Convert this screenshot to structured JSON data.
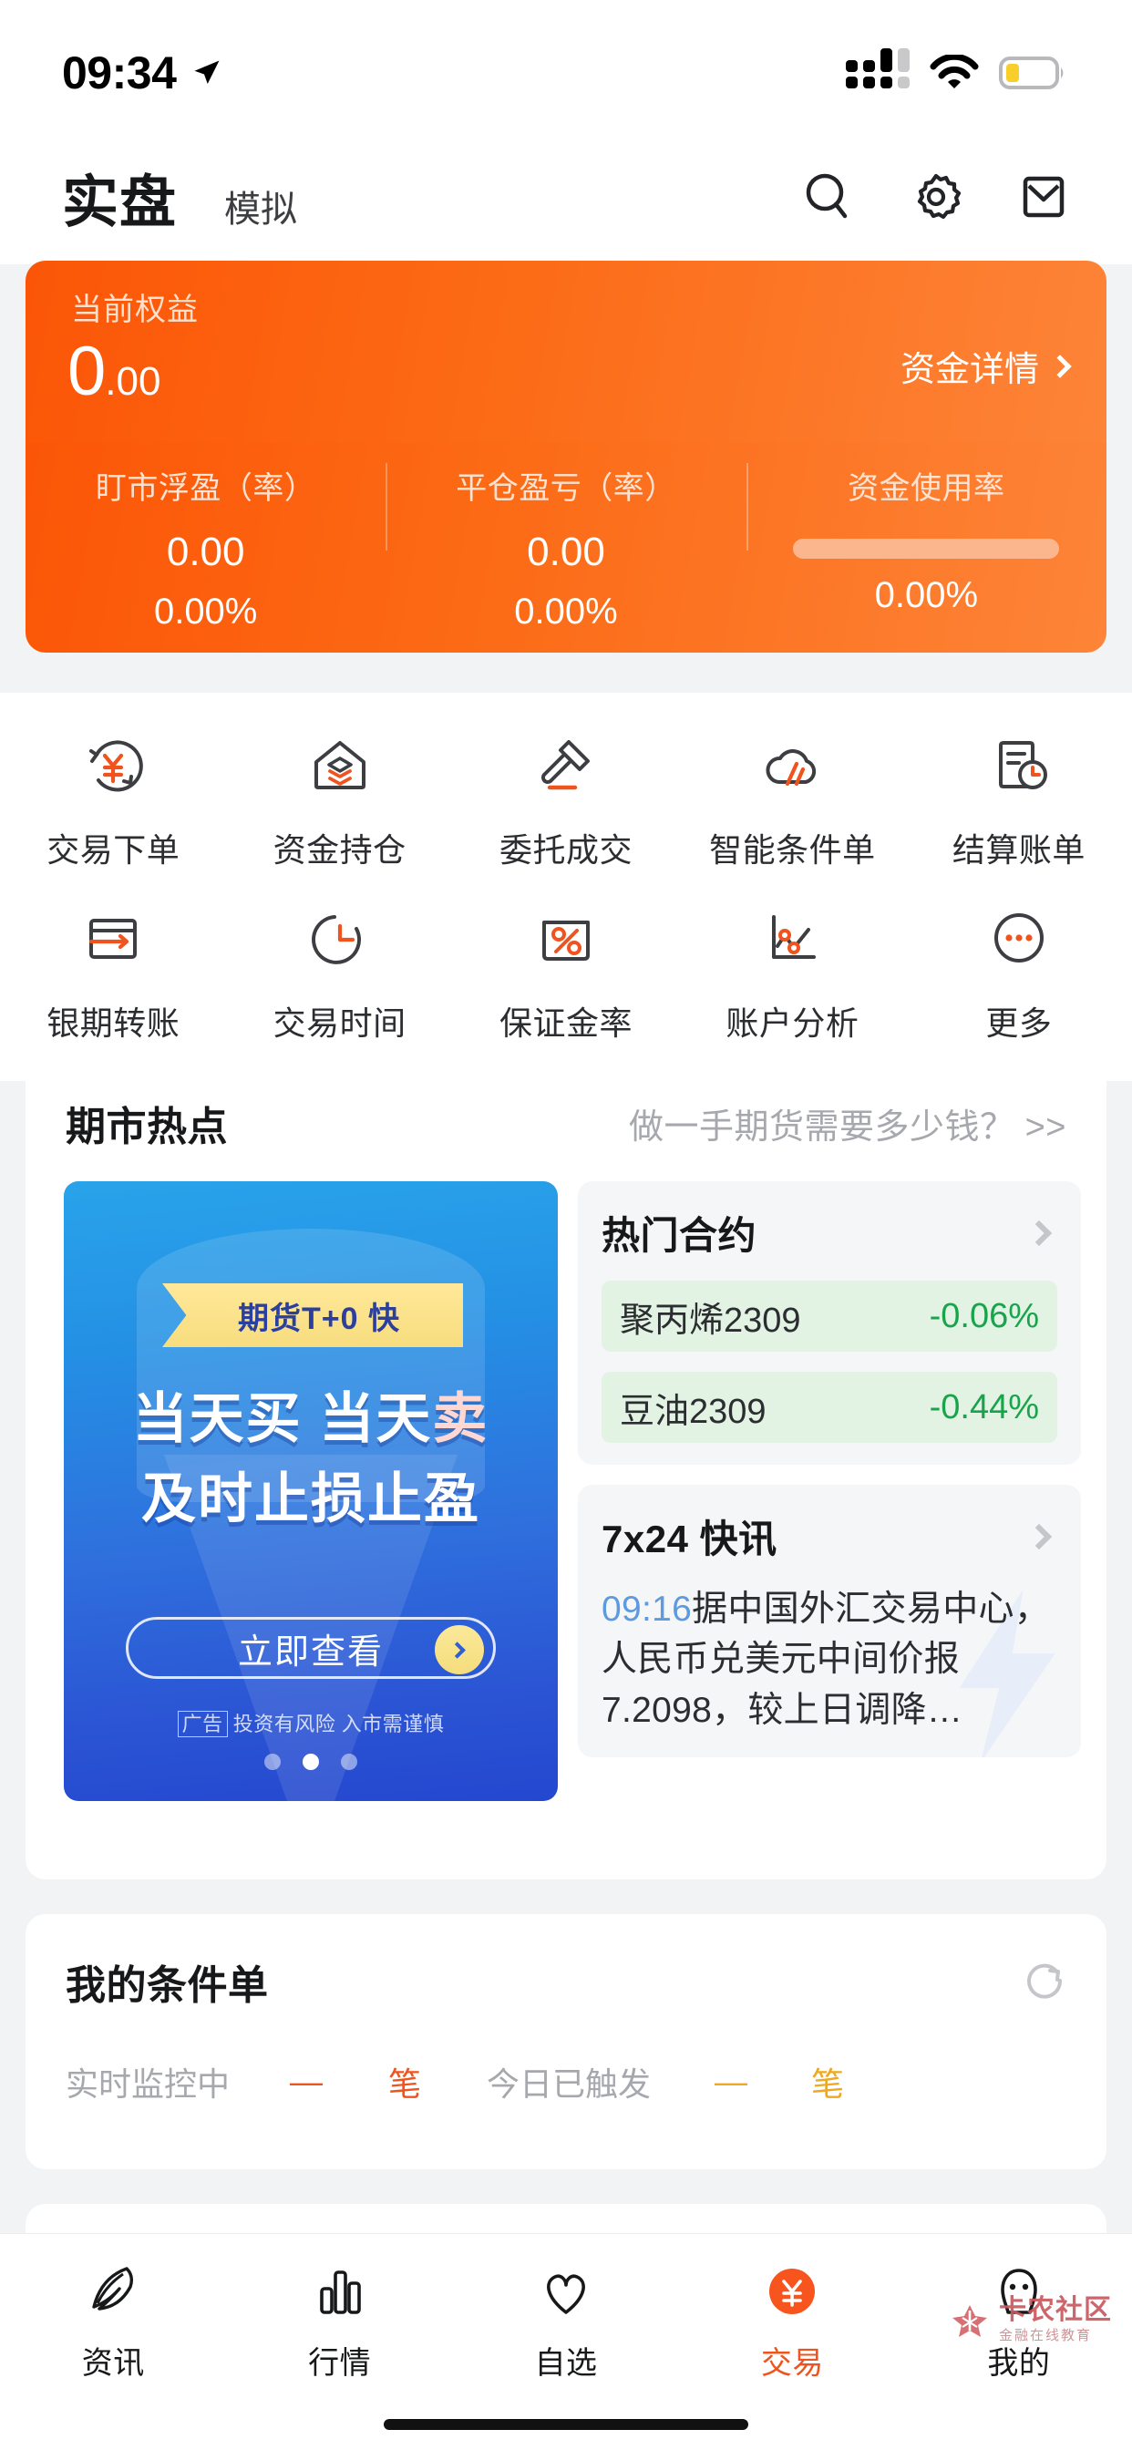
{
  "status_bar": {
    "time": "09:34",
    "location_icon": "location-arrow-icon",
    "signal_icon": "cellular-signal-icon",
    "wifi_icon": "wifi-icon",
    "battery_icon": "battery-low-power-icon"
  },
  "header": {
    "tab_live": "实盘",
    "tab_sim": "模拟",
    "search_icon": "search-icon",
    "settings_icon": "gear-icon",
    "mail_icon": "mail-icon"
  },
  "equity": {
    "label": "当前权益",
    "value_int": "0",
    "value_dec": ".00",
    "detail_link": "资金详情",
    "stats": [
      {
        "label": "盯市浮盈（率）",
        "value": "0.00",
        "percent": "0.00%",
        "type": "text"
      },
      {
        "label": "平仓盈亏（率）",
        "value": "0.00",
        "percent": "0.00%",
        "type": "text"
      },
      {
        "label": "资金使用率",
        "value": "",
        "percent": "0.00%",
        "type": "bar",
        "bar_pct": 0
      }
    ],
    "accent": "#fb5607"
  },
  "quick_actions": {
    "row1": [
      {
        "label": "交易下单",
        "icon": "yen-refresh-icon"
      },
      {
        "label": "资金持仓",
        "icon": "house-layers-icon"
      },
      {
        "label": "委托成交",
        "icon": "gavel-icon"
      },
      {
        "label": "智能条件单",
        "icon": "cloud-lightning-icon"
      },
      {
        "label": "结算账单",
        "icon": "document-clock-icon"
      }
    ],
    "row2": [
      {
        "label": "银期转账",
        "icon": "card-transfer-icon"
      },
      {
        "label": "交易时间",
        "icon": "clock-icon"
      },
      {
        "label": "保证金率",
        "icon": "percent-box-icon"
      },
      {
        "label": "账户分析",
        "icon": "line-chart-icon"
      },
      {
        "label": "更多",
        "icon": "ellipsis-circle-icon"
      }
    ]
  },
  "hotspot": {
    "title": "期市热点",
    "more_text": "做一手期货需要多少钱？ >>",
    "banner": {
      "ribbon": "期货T+0 快",
      "line1_a": "当天买 当天",
      "line1_b": "卖",
      "line2": "及时止损止盈",
      "cta": "立即查看",
      "ad_tag": "广告",
      "disclaimer": "投资有风险 入市需谨慎",
      "dots_total": 3,
      "dot_active": 2
    },
    "hot_contracts": {
      "title": "热门合约",
      "chevron_icon": "chevron-right-icon",
      "items": [
        {
          "name": "聚丙烯2309",
          "change": "-0.06%"
        },
        {
          "name": "豆油2309",
          "change": "-0.44%"
        }
      ],
      "down_color": "#19a44c",
      "row_bg": "#e2f3e4"
    },
    "news": {
      "title": "7x24 快讯",
      "chevron_icon": "chevron-right-icon",
      "time": "09:16",
      "text": "据中国外汇交易中心，人民币兑美元中间价报7.2098，较上日调降…",
      "bolt_icon": "lightning-bolt-icon"
    }
  },
  "my_conditional_orders": {
    "title": "我的条件单",
    "refresh_icon": "refresh-icon",
    "monitor_label": "实时监控中",
    "monitor_count": "—",
    "monitor_unit": "笔",
    "triggered_label": "今日已触发",
    "triggered_count": "—",
    "triggered_unit": "笔",
    "monitor_color": "#f0541e",
    "triggered_color": "#f0a91e"
  },
  "bottom_nav": {
    "items": [
      {
        "label": "资讯",
        "icon": "news-feather-icon",
        "active": false
      },
      {
        "label": "行情",
        "icon": "bar-chart-icon",
        "active": false
      },
      {
        "label": "自选",
        "icon": "heart-icon",
        "active": false
      },
      {
        "label": "交易",
        "icon": "yen-circle-icon",
        "active": true
      },
      {
        "label": "我的",
        "icon": "person-icon",
        "active": false
      }
    ],
    "active_color": "#f0541e"
  },
  "watermark": {
    "line1": "卡农社区",
    "line2": "金融在线教育",
    "icon": "watermark-logo-icon"
  }
}
